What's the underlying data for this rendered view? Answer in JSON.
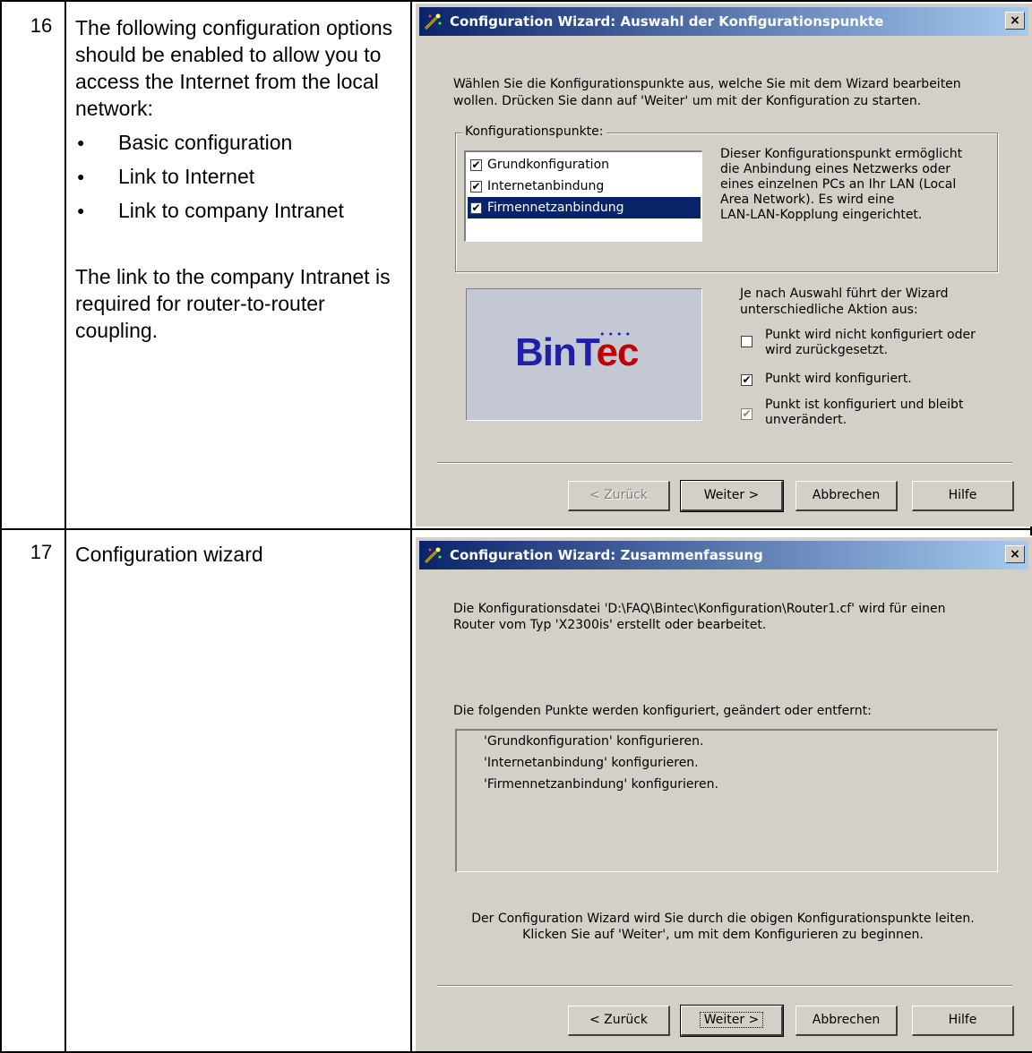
{
  "row16": {
    "number": "16",
    "intro": "The following configuration options should be enabled to allow you to access the Internet from the local network:",
    "bullets": [
      "Basic configuration",
      "Link to Internet",
      "Link to company Intranet"
    ],
    "note": "The link to the company Intranet is required for router-to-router coupling."
  },
  "row17": {
    "number": "17",
    "text": "Configuration wizard"
  },
  "dialog1": {
    "title": "Configuration Wizard: Auswahl der Konfigurationspunkte",
    "close": "×",
    "intro1": "Wählen Sie die Konfigurationspunkte aus, welche Sie mit dem Wizard bearbeiten",
    "intro2": "wollen. Drücken Sie dann auf 'Weiter' um mit der Konfiguration zu starten.",
    "group_label": "Konfigurationspunkte:",
    "items": [
      "Grundkonfiguration",
      "Internetanbindung",
      "Firmennetzanbindung"
    ],
    "item_check": "✔",
    "description": [
      "Dieser Konfigurationspunkt ermöglicht",
      "die Anbindung eines Netzwerks oder",
      "eines einzelnen PCs an Ihr LAN (Local",
      "Area Network). Es wird eine",
      "LAN-LAN-Kopplung eingerichtet."
    ],
    "logo_part1": "BinT",
    "logo_part2": "ec",
    "logo_dots": "••••",
    "legend_intro": [
      "Je nach Auswahl führt der Wizard",
      "unterschiedliche Aktion aus:"
    ],
    "legend_unchecked": [
      "Punkt wird nicht konfiguriert oder",
      "wird zurückgesetzt."
    ],
    "legend_checked": "Punkt wird konfiguriert.",
    "legend_gray": [
      "Punkt ist konfiguriert und bleibt",
      "unverändert."
    ],
    "check_mark": "✔",
    "buttons": {
      "back": "< Zurück",
      "next": "Weiter >",
      "cancel": "Abbrechen",
      "help": "Hilfe"
    }
  },
  "dialog2": {
    "title": "Configuration Wizard: Zusammenfassung",
    "close": "×",
    "line1": "Die Konfigurationsdatei 'D:\\FAQ\\Bintec\\Konfiguration\\Router1.cf' wird für einen",
    "line2": "Router vom Typ 'X2300is' erstellt oder bearbeitet.",
    "list_header": "Die folgenden Punkte werden konfiguriert, geändert oder entfernt:",
    "list": [
      "'Grundkonfiguration' konfigurieren.",
      "'Internetanbindung' konfigurieren.",
      "'Firmennetzanbindung' konfigurieren."
    ],
    "footer1": "Der Configuration Wizard wird Sie durch die obigen Konfigurationspunkte leiten.",
    "footer2": "Klicken Sie auf 'Weiter', um mit dem Konfigurieren zu beginnen.",
    "buttons": {
      "back": "< Zurück",
      "next": "Weiter >",
      "cancel": "Abbrechen",
      "help": "Hilfe"
    }
  }
}
